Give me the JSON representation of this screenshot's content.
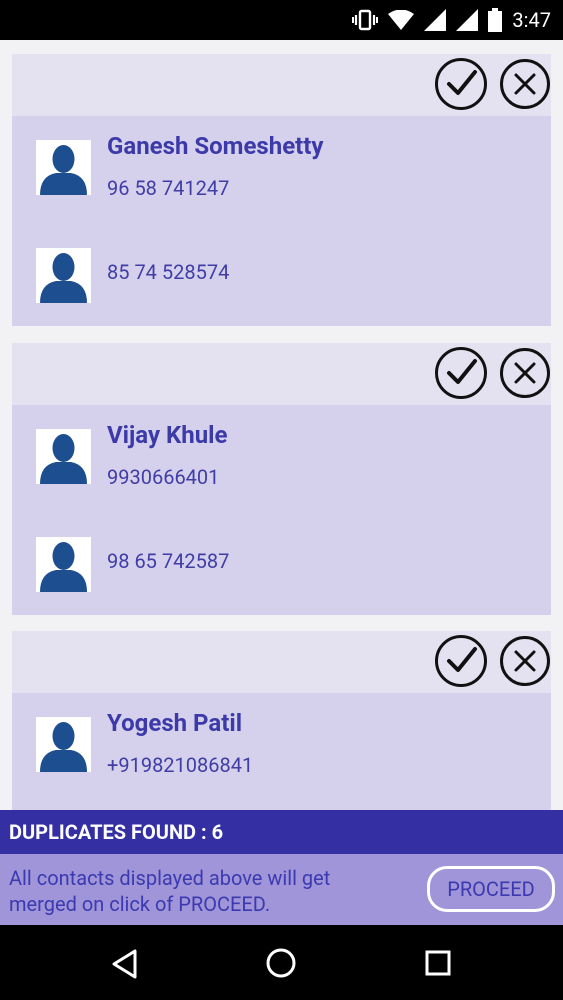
{
  "status_bar": {
    "time": "3:47",
    "icons": [
      "vibrate-icon",
      "wifi-icon",
      "signal-icon",
      "signal-icon",
      "battery-icon"
    ]
  },
  "cards": [
    {
      "name": "Ganesh Someshetty",
      "entries": [
        {
          "phone": "96 58 741247"
        },
        {
          "phone": "85 74 528574"
        }
      ]
    },
    {
      "name": "Vijay Khule",
      "entries": [
        {
          "phone": "9930666401"
        },
        {
          "phone": "98 65 742587"
        }
      ]
    },
    {
      "name": "Yogesh Patil",
      "entries": [
        {
          "phone": "+919821086841"
        }
      ]
    }
  ],
  "footer": {
    "duplicates_label": "DUPLICATES FOUND : 6",
    "info_text": "All contacts displayed above will get merged on click of PROCEED.",
    "proceed_label": "PROCEED"
  },
  "colors": {
    "accent": "#3430a4",
    "card_body": "#d5d0ec",
    "card_head": "#e4e2f1",
    "avatar": "#1d4e8f",
    "info_bar": "#9f95d8"
  }
}
